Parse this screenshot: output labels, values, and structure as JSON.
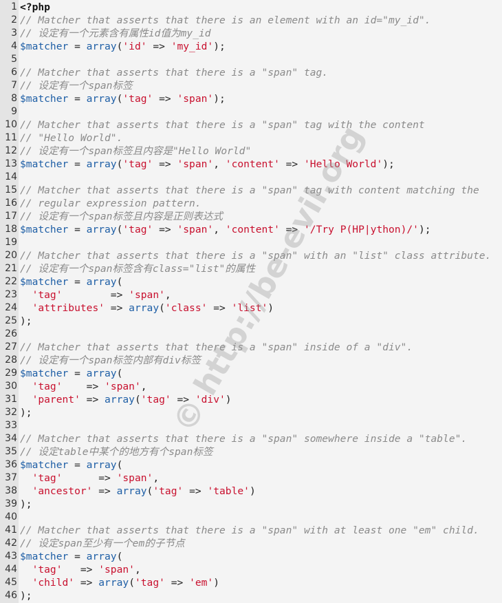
{
  "watermark": "© http://be-evil.org",
  "colors": {
    "comment": "#8a8a8a",
    "variable": "#1f5fa6",
    "string": "#c8102e",
    "gutter": "#e4e4e4",
    "background": "#f4f4f4"
  },
  "lines": [
    [
      [
        "k",
        "<?php"
      ]
    ],
    [
      [
        "c",
        "// Matcher that asserts that there is an element with an id=\"my_id\"."
      ]
    ],
    [
      [
        "c",
        "// 设定有一个元素含有属性id值为my_id"
      ]
    ],
    [
      [
        "v",
        "$matcher"
      ],
      [
        "p",
        " = "
      ],
      [
        "f",
        "array"
      ],
      [
        "p",
        "("
      ],
      [
        "s",
        "'id'"
      ],
      [
        "p",
        " => "
      ],
      [
        "s",
        "'my_id'"
      ],
      [
        "p",
        ");"
      ]
    ],
    [],
    [
      [
        "c",
        "// Matcher that asserts that there is a \"span\" tag."
      ]
    ],
    [
      [
        "c",
        "// 设定有一个span标签"
      ]
    ],
    [
      [
        "v",
        "$matcher"
      ],
      [
        "p",
        " = "
      ],
      [
        "f",
        "array"
      ],
      [
        "p",
        "("
      ],
      [
        "s",
        "'tag'"
      ],
      [
        "p",
        " => "
      ],
      [
        "s",
        "'span'"
      ],
      [
        "p",
        ");"
      ]
    ],
    [],
    [
      [
        "c",
        "// Matcher that asserts that there is a \"span\" tag with the content"
      ]
    ],
    [
      [
        "c",
        "// \"Hello World\"."
      ]
    ],
    [
      [
        "c",
        "// 设定有一个span标签且内容是\"Hello World\""
      ]
    ],
    [
      [
        "v",
        "$matcher"
      ],
      [
        "p",
        " = "
      ],
      [
        "f",
        "array"
      ],
      [
        "p",
        "("
      ],
      [
        "s",
        "'tag'"
      ],
      [
        "p",
        " => "
      ],
      [
        "s",
        "'span'"
      ],
      [
        "p",
        ", "
      ],
      [
        "s",
        "'content'"
      ],
      [
        "p",
        " => "
      ],
      [
        "s",
        "'Hello World'"
      ],
      [
        "p",
        ");"
      ]
    ],
    [],
    [
      [
        "c",
        "// Matcher that asserts that there is a \"span\" tag with content matching the"
      ]
    ],
    [
      [
        "c",
        "// regular expression pattern."
      ]
    ],
    [
      [
        "c",
        "// 设定有一个span标签且内容是正则表达式"
      ]
    ],
    [
      [
        "v",
        "$matcher"
      ],
      [
        "p",
        " = "
      ],
      [
        "f",
        "array"
      ],
      [
        "p",
        "("
      ],
      [
        "s",
        "'tag'"
      ],
      [
        "p",
        " => "
      ],
      [
        "s",
        "'span'"
      ],
      [
        "p",
        ", "
      ],
      [
        "s",
        "'content'"
      ],
      [
        "p",
        " => "
      ],
      [
        "s",
        "'/Try P(HP|ython)/'"
      ],
      [
        "p",
        ");"
      ]
    ],
    [],
    [
      [
        "c",
        "// Matcher that asserts that there is a \"span\" with an \"list\" class attribute."
      ]
    ],
    [
      [
        "c",
        "// 设定有一个span标签含有class=\"list\"的属性"
      ]
    ],
    [
      [
        "v",
        "$matcher"
      ],
      [
        "p",
        " = "
      ],
      [
        "f",
        "array"
      ],
      [
        "p",
        "("
      ]
    ],
    [
      [
        "p",
        "  "
      ],
      [
        "s",
        "'tag'"
      ],
      [
        "p",
        "        => "
      ],
      [
        "s",
        "'span'"
      ],
      [
        "p",
        ","
      ]
    ],
    [
      [
        "p",
        "  "
      ],
      [
        "s",
        "'attributes'"
      ],
      [
        "p",
        " => "
      ],
      [
        "f",
        "array"
      ],
      [
        "p",
        "("
      ],
      [
        "s",
        "'class'"
      ],
      [
        "p",
        " => "
      ],
      [
        "s",
        "'list'"
      ],
      [
        "p",
        ")"
      ]
    ],
    [
      [
        "p",
        ");"
      ]
    ],
    [],
    [
      [
        "c",
        "// Matcher that asserts that there is a \"span\" inside of a \"div\"."
      ]
    ],
    [
      [
        "c",
        "// 设定有一个span标签内部有div标签"
      ]
    ],
    [
      [
        "v",
        "$matcher"
      ],
      [
        "p",
        " = "
      ],
      [
        "f",
        "array"
      ],
      [
        "p",
        "("
      ]
    ],
    [
      [
        "p",
        "  "
      ],
      [
        "s",
        "'tag'"
      ],
      [
        "p",
        "    => "
      ],
      [
        "s",
        "'span'"
      ],
      [
        "p",
        ","
      ]
    ],
    [
      [
        "p",
        "  "
      ],
      [
        "s",
        "'parent'"
      ],
      [
        "p",
        " => "
      ],
      [
        "f",
        "array"
      ],
      [
        "p",
        "("
      ],
      [
        "s",
        "'tag'"
      ],
      [
        "p",
        " => "
      ],
      [
        "s",
        "'div'"
      ],
      [
        "p",
        ")"
      ]
    ],
    [
      [
        "p",
        ");"
      ]
    ],
    [],
    [
      [
        "c",
        "// Matcher that asserts that there is a \"span\" somewhere inside a \"table\"."
      ]
    ],
    [
      [
        "c",
        "// 设定table中某个的地方有个span标签"
      ]
    ],
    [
      [
        "v",
        "$matcher"
      ],
      [
        "p",
        " = "
      ],
      [
        "f",
        "array"
      ],
      [
        "p",
        "("
      ]
    ],
    [
      [
        "p",
        "  "
      ],
      [
        "s",
        "'tag'"
      ],
      [
        "p",
        "      => "
      ],
      [
        "s",
        "'span'"
      ],
      [
        "p",
        ","
      ]
    ],
    [
      [
        "p",
        "  "
      ],
      [
        "s",
        "'ancestor'"
      ],
      [
        "p",
        " => "
      ],
      [
        "f",
        "array"
      ],
      [
        "p",
        "("
      ],
      [
        "s",
        "'tag'"
      ],
      [
        "p",
        " => "
      ],
      [
        "s",
        "'table'"
      ],
      [
        "p",
        ")"
      ]
    ],
    [
      [
        "p",
        ");"
      ]
    ],
    [],
    [
      [
        "c",
        "// Matcher that asserts that there is a \"span\" with at least one \"em\" child."
      ]
    ],
    [
      [
        "c",
        "// 设定span至少有一个em的子节点"
      ]
    ],
    [
      [
        "v",
        "$matcher"
      ],
      [
        "p",
        " = "
      ],
      [
        "f",
        "array"
      ],
      [
        "p",
        "("
      ]
    ],
    [
      [
        "p",
        "  "
      ],
      [
        "s",
        "'tag'"
      ],
      [
        "p",
        "   => "
      ],
      [
        "s",
        "'span'"
      ],
      [
        "p",
        ","
      ]
    ],
    [
      [
        "p",
        "  "
      ],
      [
        "s",
        "'child'"
      ],
      [
        "p",
        " => "
      ],
      [
        "f",
        "array"
      ],
      [
        "p",
        "("
      ],
      [
        "s",
        "'tag'"
      ],
      [
        "p",
        " => "
      ],
      [
        "s",
        "'em'"
      ],
      [
        "p",
        ")"
      ]
    ],
    [
      [
        "p",
        ");"
      ]
    ]
  ]
}
